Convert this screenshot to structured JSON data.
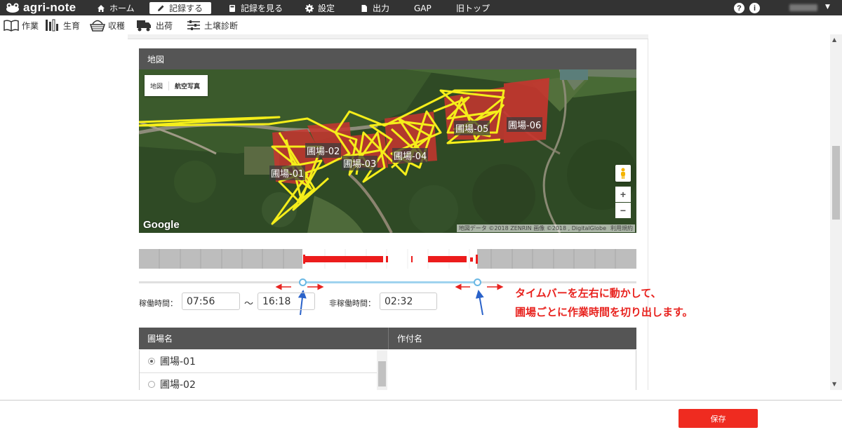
{
  "app": {
    "logo": "agri-note"
  },
  "topnav": {
    "items": [
      {
        "label": "ホーム",
        "icon": "home-icon"
      },
      {
        "label": "記録する",
        "icon": "pencil-icon",
        "active": true
      },
      {
        "label": "記録を見る",
        "icon": "book-icon"
      },
      {
        "label": "設定",
        "icon": "gear-icon"
      },
      {
        "label": "出力",
        "icon": "document-icon"
      },
      {
        "label": "GAP"
      },
      {
        "label": "旧トップ"
      }
    ],
    "help": "?",
    "info": "i"
  },
  "subnav": {
    "items": [
      {
        "label": "作業",
        "icon": "book-open-icon"
      },
      {
        "label": "生育",
        "icon": "bars-icon"
      },
      {
        "label": "収穫",
        "icon": "basket-icon"
      },
      {
        "label": "出荷",
        "icon": "truck-icon"
      },
      {
        "label": "土壌診断",
        "icon": "sliders-icon"
      }
    ]
  },
  "map": {
    "section_title": "地図",
    "toggle": [
      "地図",
      "航空写真"
    ],
    "fields": [
      "圃場-01",
      "圃場-02",
      "圃場-03",
      "圃場-04",
      "圃場-05",
      "圃場-06"
    ],
    "zoom_in": "+",
    "zoom_out": "−",
    "google": "Google",
    "attribution": "地図データ ©2018 ZENRIN 画像 ©2018 , DigitalGlobe",
    "terms": "利用規約"
  },
  "time": {
    "working_label": "稼働時間：",
    "start": "07:56",
    "separator": "〜",
    "end": "16:18",
    "idle_label": "非稼働時間：",
    "idle": "02:32"
  },
  "annotation": {
    "line1": "タイムバーを左右に動かして、",
    "line2": "圃場ごとに作業時間を切り出します。"
  },
  "table": {
    "col_field": "圃場名",
    "col_crop": "作付名",
    "rows": [
      {
        "label": "圃場-01",
        "checked": true
      },
      {
        "label": "圃場-02",
        "checked": false
      }
    ]
  },
  "footer": {
    "save": "保存"
  },
  "colors": {
    "accent": "#ef2b20",
    "nav": "#333333",
    "header": "#555555",
    "slider": "#6ab8e4"
  }
}
